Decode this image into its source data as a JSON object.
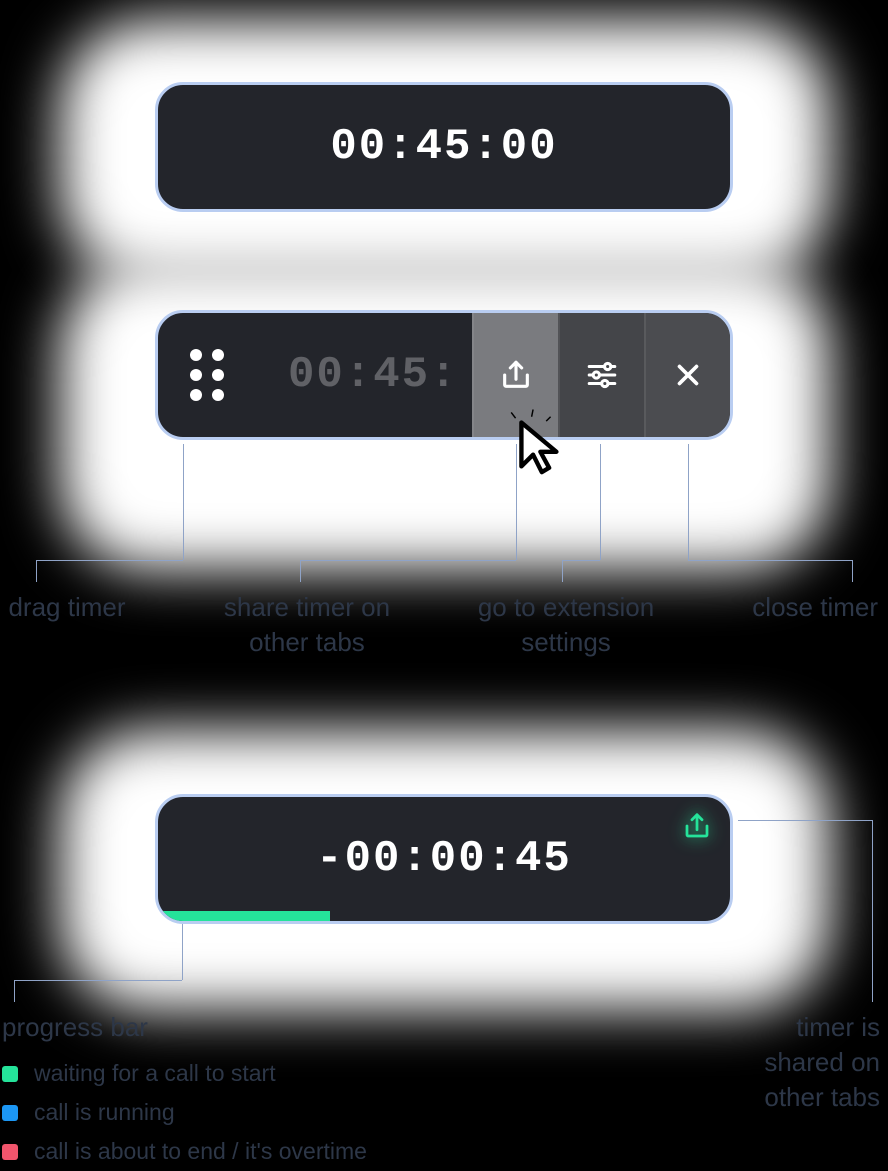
{
  "timers": {
    "idle": {
      "display": "00:45:00"
    },
    "hover": {
      "display": "00:45:"
    },
    "running": {
      "display": "-00:00:45",
      "progress_pct": 30
    }
  },
  "labels": {
    "drag": "drag timer",
    "share": "share timer on other tabs",
    "settings": "go to extension settings",
    "close": "close timer",
    "progress_title": "progress bar",
    "shared_status": "timer is shared on other tabs"
  },
  "legend": [
    {
      "color": "#25e39a",
      "text": "waiting for a call to start"
    },
    {
      "color": "#1c97f4",
      "text": "call is running"
    },
    {
      "color": "#f1556c",
      "text": "call is about to end / it's overtime"
    }
  ],
  "colors": {
    "pill_bg": "#23252b",
    "pill_border": "#b9cdf1",
    "accent_green": "#25e39a",
    "label_text": "#2d3748"
  }
}
